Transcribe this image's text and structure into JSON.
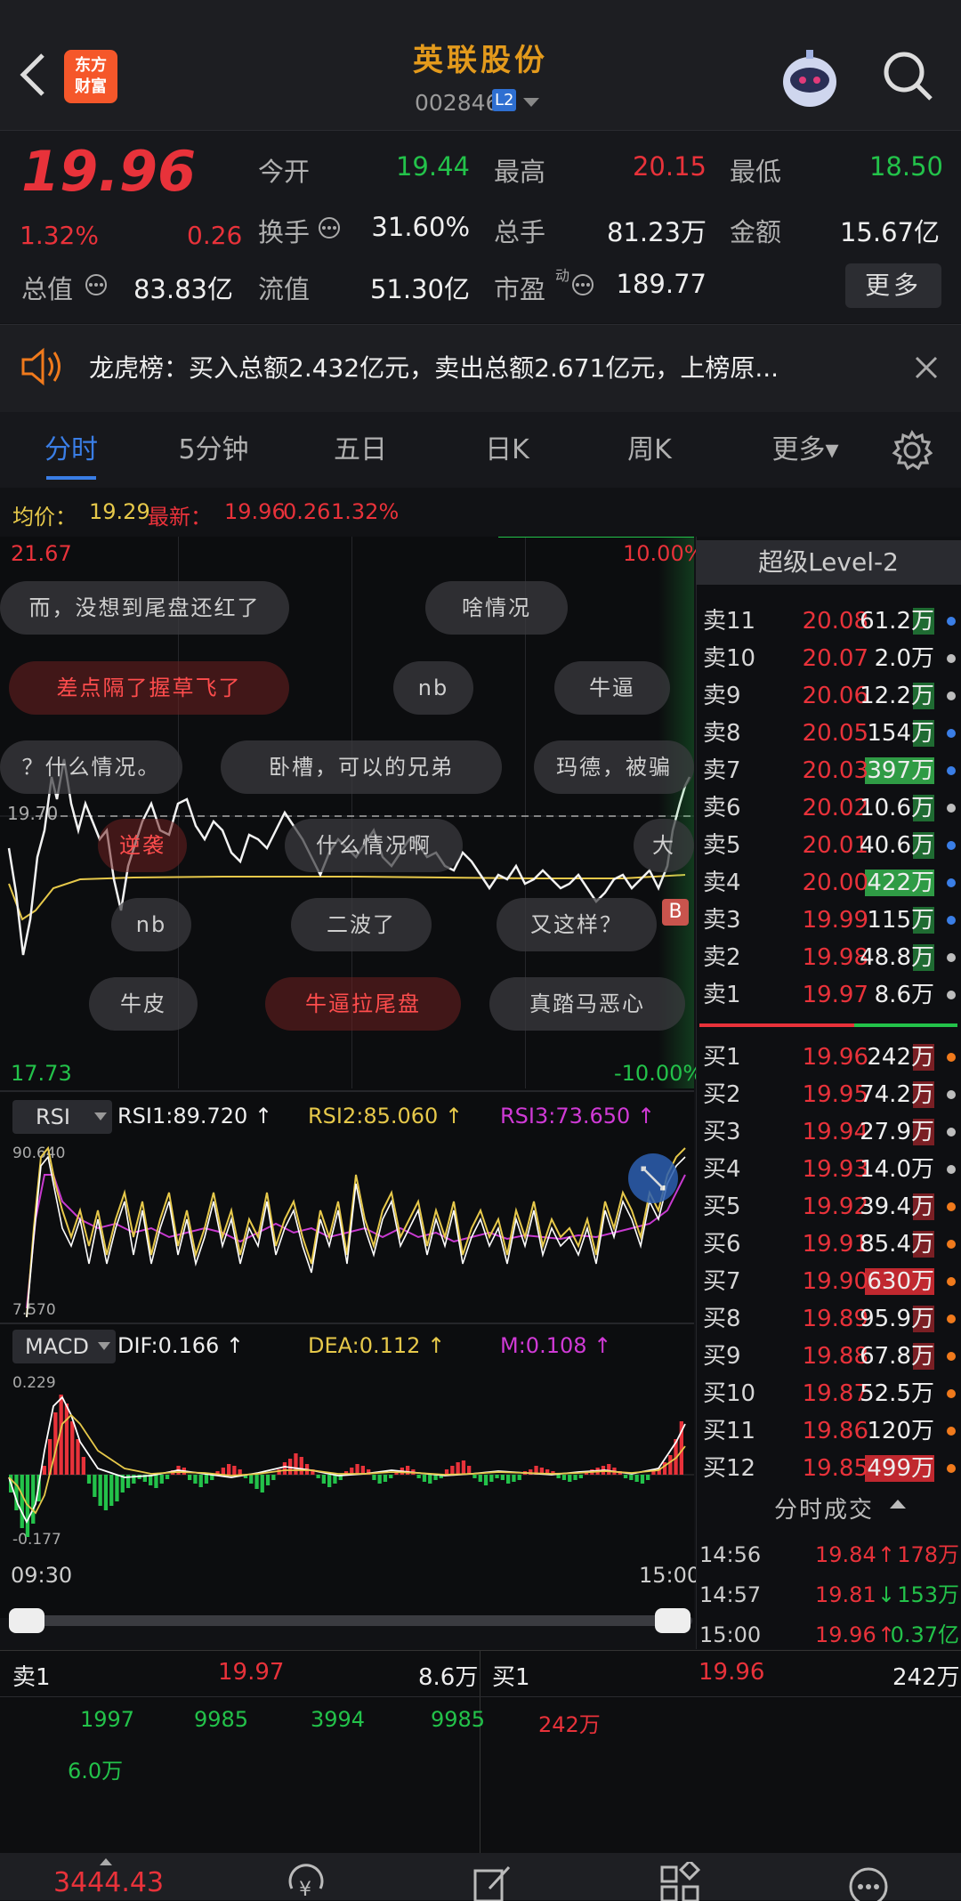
{
  "header": {
    "title": "英联股份",
    "code": "002846",
    "l2": "L2",
    "logo_text": "东方\n财富"
  },
  "quote": {
    "price": "19.96",
    "pct": "1.32%",
    "chg": "0.26",
    "open_lbl": "今开",
    "open": "19.44",
    "high_lbl": "最高",
    "high": "20.15",
    "low_lbl": "最低",
    "low": "18.50",
    "turn_lbl": "换手",
    "turn": "31.60%",
    "vol_lbl": "总手",
    "vol": "81.23万",
    "amt_lbl": "金额",
    "amt": "15.67亿",
    "mcap_lbl": "总值",
    "mcap": "83.83亿",
    "flt_lbl": "流值",
    "flt": "51.30亿",
    "pe_lbl": "市盈",
    "pe_sup": "动",
    "pe": "189.77",
    "more": "更多"
  },
  "notice": {
    "text": "龙虎榜：买入总额2.432亿元，卖出总额2.671亿元，上榜原..."
  },
  "tabs": [
    "分时",
    "5分钟",
    "五日",
    "日K",
    "周K",
    "更多▾"
  ],
  "info": {
    "avg_lbl": "均价：",
    "avg": "19.29",
    "last_lbl": "最新：",
    "last": "19.96",
    "chg": "0.26",
    "pct": "1.32%"
  },
  "chart": {
    "top_price": "21.67",
    "top_pct": "10.00%",
    "bottom_price": "17.73",
    "bottom_pct": "-10.00%",
    "dash_price": "19.70",
    "b_mark": "B",
    "rsi_btn": "RSI",
    "rsi1": "RSI1:89.720 ↑",
    "rsi2": "RSI2:85.060 ↑",
    "rsi3": "RSI3:73.650 ↑",
    "rsi_top": "90.640",
    "rsi_bot": "7.570",
    "macd_btn": "MACD",
    "dif": "DIF:0.166 ↑",
    "dea": "DEA:0.112 ↑",
    "m": "M:0.108 ↑",
    "macd_top": "0.229",
    "macd_bot": "-0.177",
    "time_start": "09:30",
    "time_end": "15:00"
  },
  "danmaku": [
    {
      "text": "而，没想到尾盘还红了",
      "red": false
    },
    {
      "text": "啥情况",
      "red": false
    },
    {
      "text": "差点隔了握草飞了",
      "red": true
    },
    {
      "text": "nb",
      "red": false
    },
    {
      "text": "牛逼",
      "red": false
    },
    {
      "text": "？什么情况。",
      "red": false
    },
    {
      "text": "卧槽，可以的兄弟",
      "red": false
    },
    {
      "text": "玛德，被骗",
      "red": false
    },
    {
      "text": "逆袭",
      "red": true
    },
    {
      "text": "什么情况啊",
      "red": false
    },
    {
      "text": "大",
      "red": false
    },
    {
      "text": "nb",
      "red": false
    },
    {
      "text": "二波了",
      "red": false
    },
    {
      "text": "又这样？",
      "red": false
    },
    {
      "text": "牛皮",
      "red": false
    },
    {
      "text": "牛逼拉尾盘",
      "red": true
    },
    {
      "text": "真踏马恶心",
      "red": false
    }
  ],
  "orderbook": {
    "title": "超级Level-2",
    "sells": [
      {
        "n": "卖11",
        "p": "20.08",
        "v": "61.2万",
        "hl": "g",
        "dot": "#3a7ee6"
      },
      {
        "n": "卖10",
        "p": "20.07",
        "v": "2.0万",
        "hl": "",
        "dot": "#bdbdbd"
      },
      {
        "n": "卖9",
        "p": "20.06",
        "v": "12.2万",
        "hl": "g",
        "dot": "#bdbdbd"
      },
      {
        "n": "卖8",
        "p": "20.05",
        "v": "154万",
        "hl": "g",
        "dot": "#3a7ee6"
      },
      {
        "n": "卖7",
        "p": "20.03",
        "v": "397万",
        "hl": "G",
        "dot": "#3a7ee6"
      },
      {
        "n": "卖6",
        "p": "20.02",
        "v": "10.6万",
        "hl": "g",
        "dot": "#bdbdbd"
      },
      {
        "n": "卖5",
        "p": "20.01",
        "v": "40.6万",
        "hl": "g",
        "dot": "#3a7ee6"
      },
      {
        "n": "卖4",
        "p": "20.00",
        "v": "422万",
        "hl": "G",
        "dot": "#3a7ee6"
      },
      {
        "n": "卖3",
        "p": "19.99",
        "v": "115万",
        "hl": "g",
        "dot": "#3a7ee6"
      },
      {
        "n": "卖2",
        "p": "19.98",
        "v": "48.8万",
        "hl": "g",
        "dot": "#bdbdbd"
      },
      {
        "n": "卖1",
        "p": "19.97",
        "v": "8.6万",
        "hl": "",
        "dot": "#bdbdbd"
      }
    ],
    "buys": [
      {
        "n": "买1",
        "p": "19.96",
        "v": "242万",
        "hl": "r",
        "dot": "#f07a1c"
      },
      {
        "n": "买2",
        "p": "19.95",
        "v": "74.2万",
        "hl": "r",
        "dot": "#bdbdbd"
      },
      {
        "n": "买3",
        "p": "19.94",
        "v": "27.9万",
        "hl": "r",
        "dot": "#bdbdbd"
      },
      {
        "n": "买4",
        "p": "19.93",
        "v": "14.0万",
        "hl": "",
        "dot": "#bdbdbd"
      },
      {
        "n": "买5",
        "p": "19.92",
        "v": "39.4万",
        "hl": "r",
        "dot": "#f07a1c"
      },
      {
        "n": "买6",
        "p": "19.91",
        "v": "85.4万",
        "hl": "r",
        "dot": "#f07a1c"
      },
      {
        "n": "买7",
        "p": "19.90",
        "v": "630万",
        "hl": "R",
        "dot": "#f07a1c"
      },
      {
        "n": "买8",
        "p": "19.89",
        "v": "95.9万",
        "hl": "r",
        "dot": "#f07a1c"
      },
      {
        "n": "买9",
        "p": "19.88",
        "v": "67.8万",
        "hl": "r",
        "dot": "#f07a1c"
      },
      {
        "n": "买10",
        "p": "19.87",
        "v": "52.5万",
        "hl": "",
        "dot": "#f07a1c"
      },
      {
        "n": "买11",
        "p": "19.86",
        "v": "120万",
        "hl": "",
        "dot": "#f07a1c"
      },
      {
        "n": "买12",
        "p": "19.85",
        "v": "499万",
        "hl": "R",
        "dot": "#f07a1c"
      }
    ],
    "ticks_title": "分时成交",
    "ticks": [
      {
        "t": "14:56",
        "p": "19.84",
        "dir": "↑",
        "v": "178万",
        "c": "red"
      },
      {
        "t": "14:57",
        "p": "19.81",
        "dir": "↓",
        "v": "153万",
        "c": "grn"
      },
      {
        "t": "15:00",
        "p": "19.96",
        "dir": "↑",
        "v": "0.37亿",
        "c": "grn"
      }
    ]
  },
  "queue": {
    "sell_lbl": "卖1",
    "sell_p": "19.97",
    "sell_v": "8.6万",
    "buy_lbl": "买1",
    "buy_p": "19.96",
    "buy_v": "242万",
    "sell_orders": [
      "1997",
      "9985",
      "3994",
      "9985",
      "6.0万"
    ],
    "buy_orders": [
      "242万"
    ]
  },
  "bottom": {
    "index": "3444.43"
  },
  "colors": {
    "up": "#e8323a",
    "down": "#23c24a",
    "accent": "#e39a1c",
    "tab_active": "#3a7ee6"
  }
}
